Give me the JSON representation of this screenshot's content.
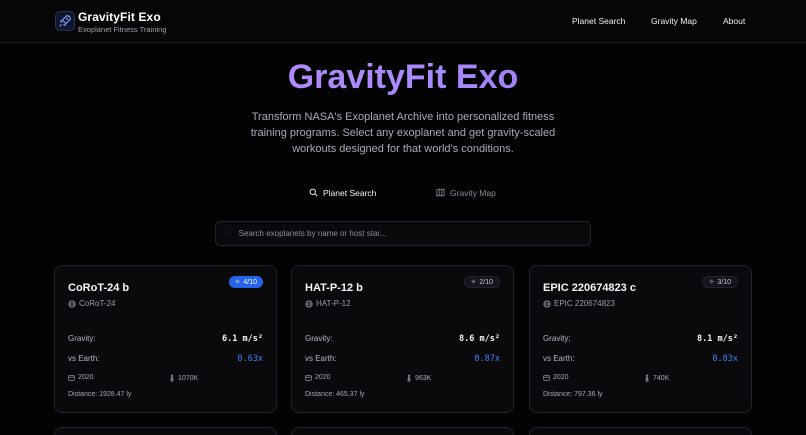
{
  "brand": {
    "title": "GravityFit Exo",
    "subtitle": "Exoplanet Fitness Training",
    "icon": "rocket-icon"
  },
  "nav": {
    "links": [
      "Planet Search",
      "Gravity Map",
      "About"
    ]
  },
  "hero": {
    "title": "GravityFit Exo",
    "description": "Transform NASA's Exoplanet Archive into personalized fitness training programs. Select any exoplanet and get gravity-scaled workouts designed for that world's conditions."
  },
  "tabs": [
    {
      "label": "Planet Search",
      "icon": "search-icon",
      "active": true
    },
    {
      "label": "Gravity Map",
      "icon": "map-icon",
      "active": false
    }
  ],
  "search": {
    "placeholder": "Search exoplanets by name or host star..."
  },
  "labels": {
    "gravity": "Gravity:",
    "vs_earth": "vs Earth:"
  },
  "cards": [
    {
      "name": "CoRoT-24 b",
      "host": "CoRoT-24",
      "badge": "4/10",
      "badge_highlight": true,
      "gravity": "6.1 m/s²",
      "vs_earth": "0.63x",
      "year": "2020",
      "distance_val": "1070K",
      "distance_text": "Distance: 1928.47 ly"
    },
    {
      "name": "HAT-P-12 b",
      "host": "HAT-P-12",
      "badge": "2/10",
      "badge_highlight": false,
      "gravity": "8.6 m/s²",
      "vs_earth": "0.87x",
      "year": "2020",
      "distance_val": "963K",
      "distance_text": "Distance: 465.37 ly"
    },
    {
      "name": "EPIC 220674823 c",
      "host": "EPIC 220674823",
      "badge": "3/10",
      "badge_highlight": false,
      "gravity": "8.1 m/s²",
      "vs_earth": "0.83x",
      "year": "2020",
      "distance_val": "740K",
      "distance_text": "Distance: 797.36 ly"
    }
  ],
  "colors": {
    "accent": "#3b82f6",
    "title_gradient_start": "#c084fc",
    "title_gradient_end": "#8b5cf6",
    "background": "#030303"
  }
}
